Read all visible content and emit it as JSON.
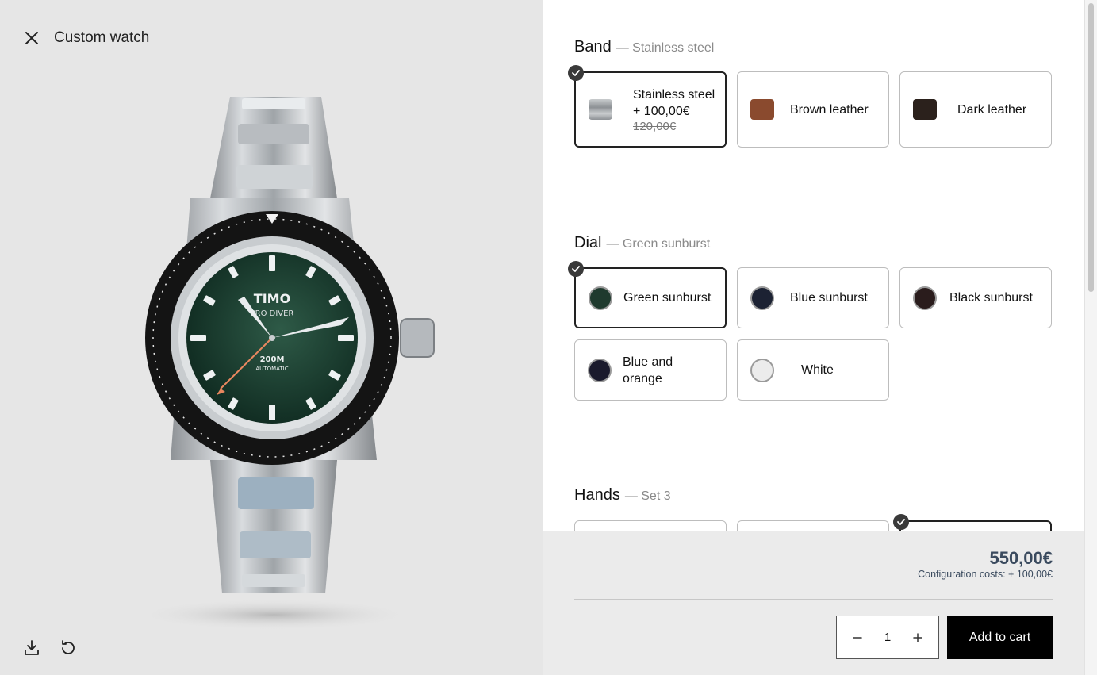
{
  "header": {
    "title": "Custom watch",
    "close_icon": "close-icon"
  },
  "watch": {
    "brand": "TIMO",
    "model": "PRO DIVER",
    "depth": "200M",
    "movement": "AUTOMATIC"
  },
  "sections": {
    "band": {
      "name": "Band",
      "selected": "— Stainless steel",
      "options": [
        {
          "label": "Stainless steel",
          "price": "+ 100,00€",
          "old_price": "120,00€",
          "color": "#9aa0a4"
        },
        {
          "label": "Brown leather",
          "color": "#8a4a2e"
        },
        {
          "label": "Dark leather",
          "color": "#2b211c"
        }
      ]
    },
    "dial": {
      "name": "Dial",
      "selected": "— Green sunburst",
      "options": [
        {
          "label": "Green sunburst",
          "color": "#1f3a2e"
        },
        {
          "label": "Blue sunburst",
          "color": "#1c2233"
        },
        {
          "label": "Black sunburst",
          "color": "#2a1c1c"
        },
        {
          "label": "Blue and orange",
          "color": "#1a1a2c"
        },
        {
          "label": "White",
          "color": "#ececec"
        }
      ]
    },
    "hands": {
      "name": "Hands",
      "selected": "— Set 3"
    }
  },
  "footer": {
    "total": "550,00€",
    "config_cost": "Configuration costs: + 100,00€",
    "quantity": "1",
    "add_to_cart": "Add to cart"
  }
}
